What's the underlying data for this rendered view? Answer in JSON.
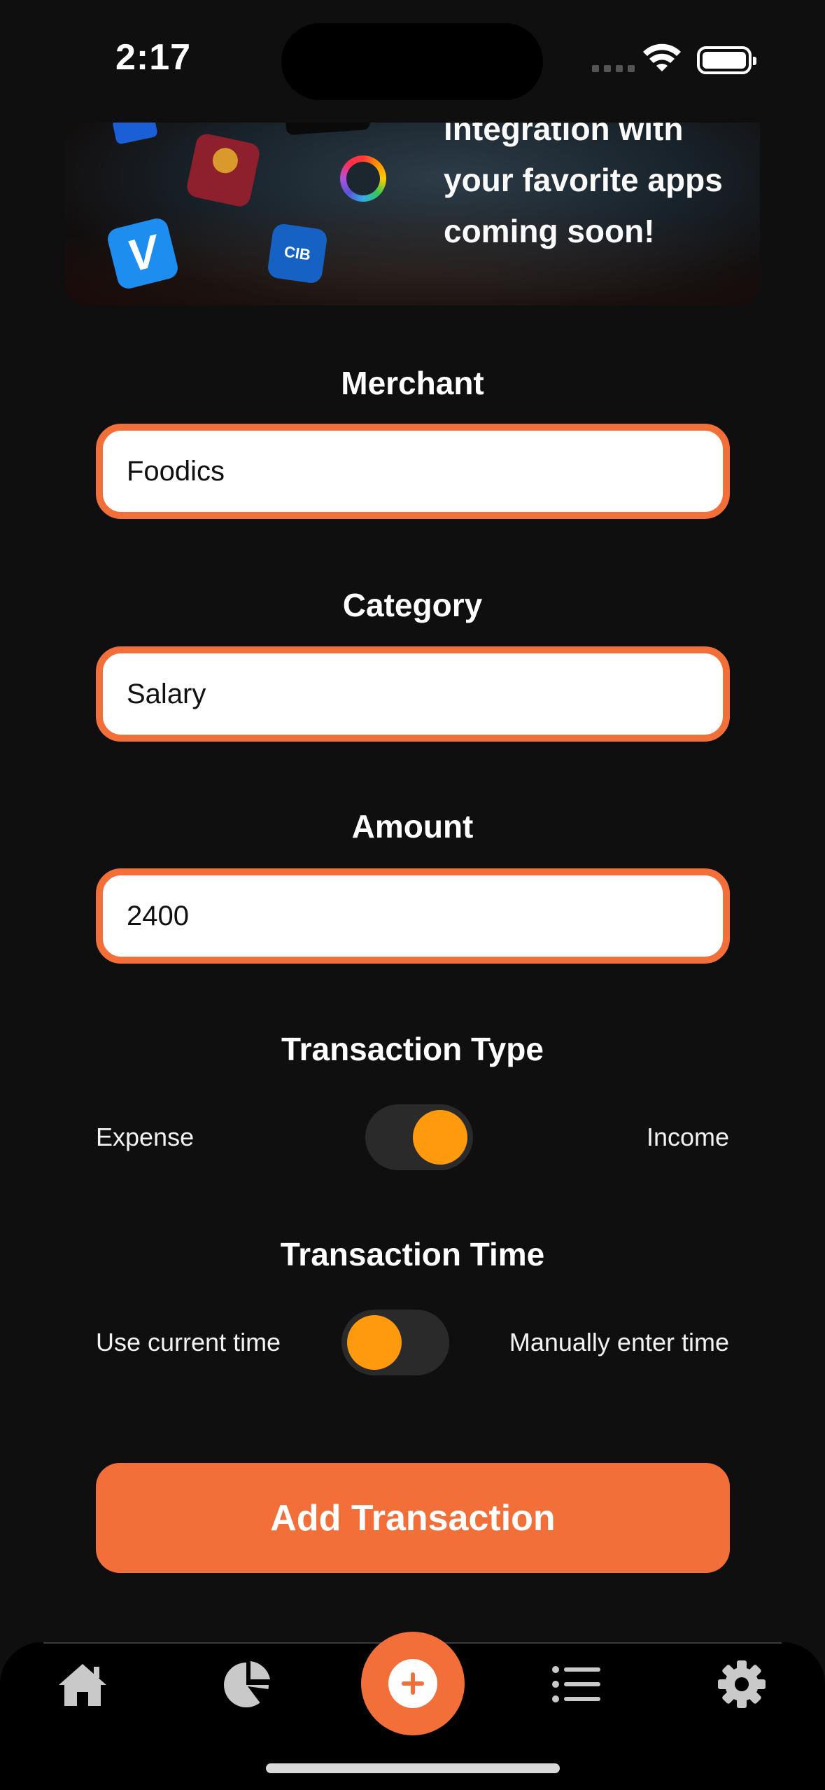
{
  "status_bar": {
    "time": "2:17"
  },
  "banner": {
    "text_lines": [
      "integration with",
      "your favorite apps",
      "coming soon!"
    ],
    "badges": [
      "paypal-icon",
      "banque-misr-icon",
      "ring-icon",
      "venmo-icon",
      "cib-icon"
    ],
    "venmo_glyph": "V",
    "cib_glyph": "CIB"
  },
  "form": {
    "merchant": {
      "label": "Merchant",
      "value": "Foodics"
    },
    "category": {
      "label": "Category",
      "value": "Salary"
    },
    "amount": {
      "label": "Amount",
      "value": "2400"
    },
    "transaction_type": {
      "label": "Transaction Type",
      "left": "Expense",
      "right": "Income",
      "is_income": true
    },
    "transaction_time": {
      "label": "Transaction Time",
      "left": "Use current time",
      "right": "Manually enter time",
      "manual": false
    },
    "submit_label": "Add Transaction"
  },
  "tab_bar": {
    "tabs": [
      "home-icon",
      "pie-chart-icon",
      "add-icon",
      "list-icon",
      "gear-icon"
    ],
    "active_accent": "#f36f3a"
  },
  "colors": {
    "accent": "#f36f3a",
    "knob": "#ff9a0f",
    "background": "#0f0f0f"
  }
}
